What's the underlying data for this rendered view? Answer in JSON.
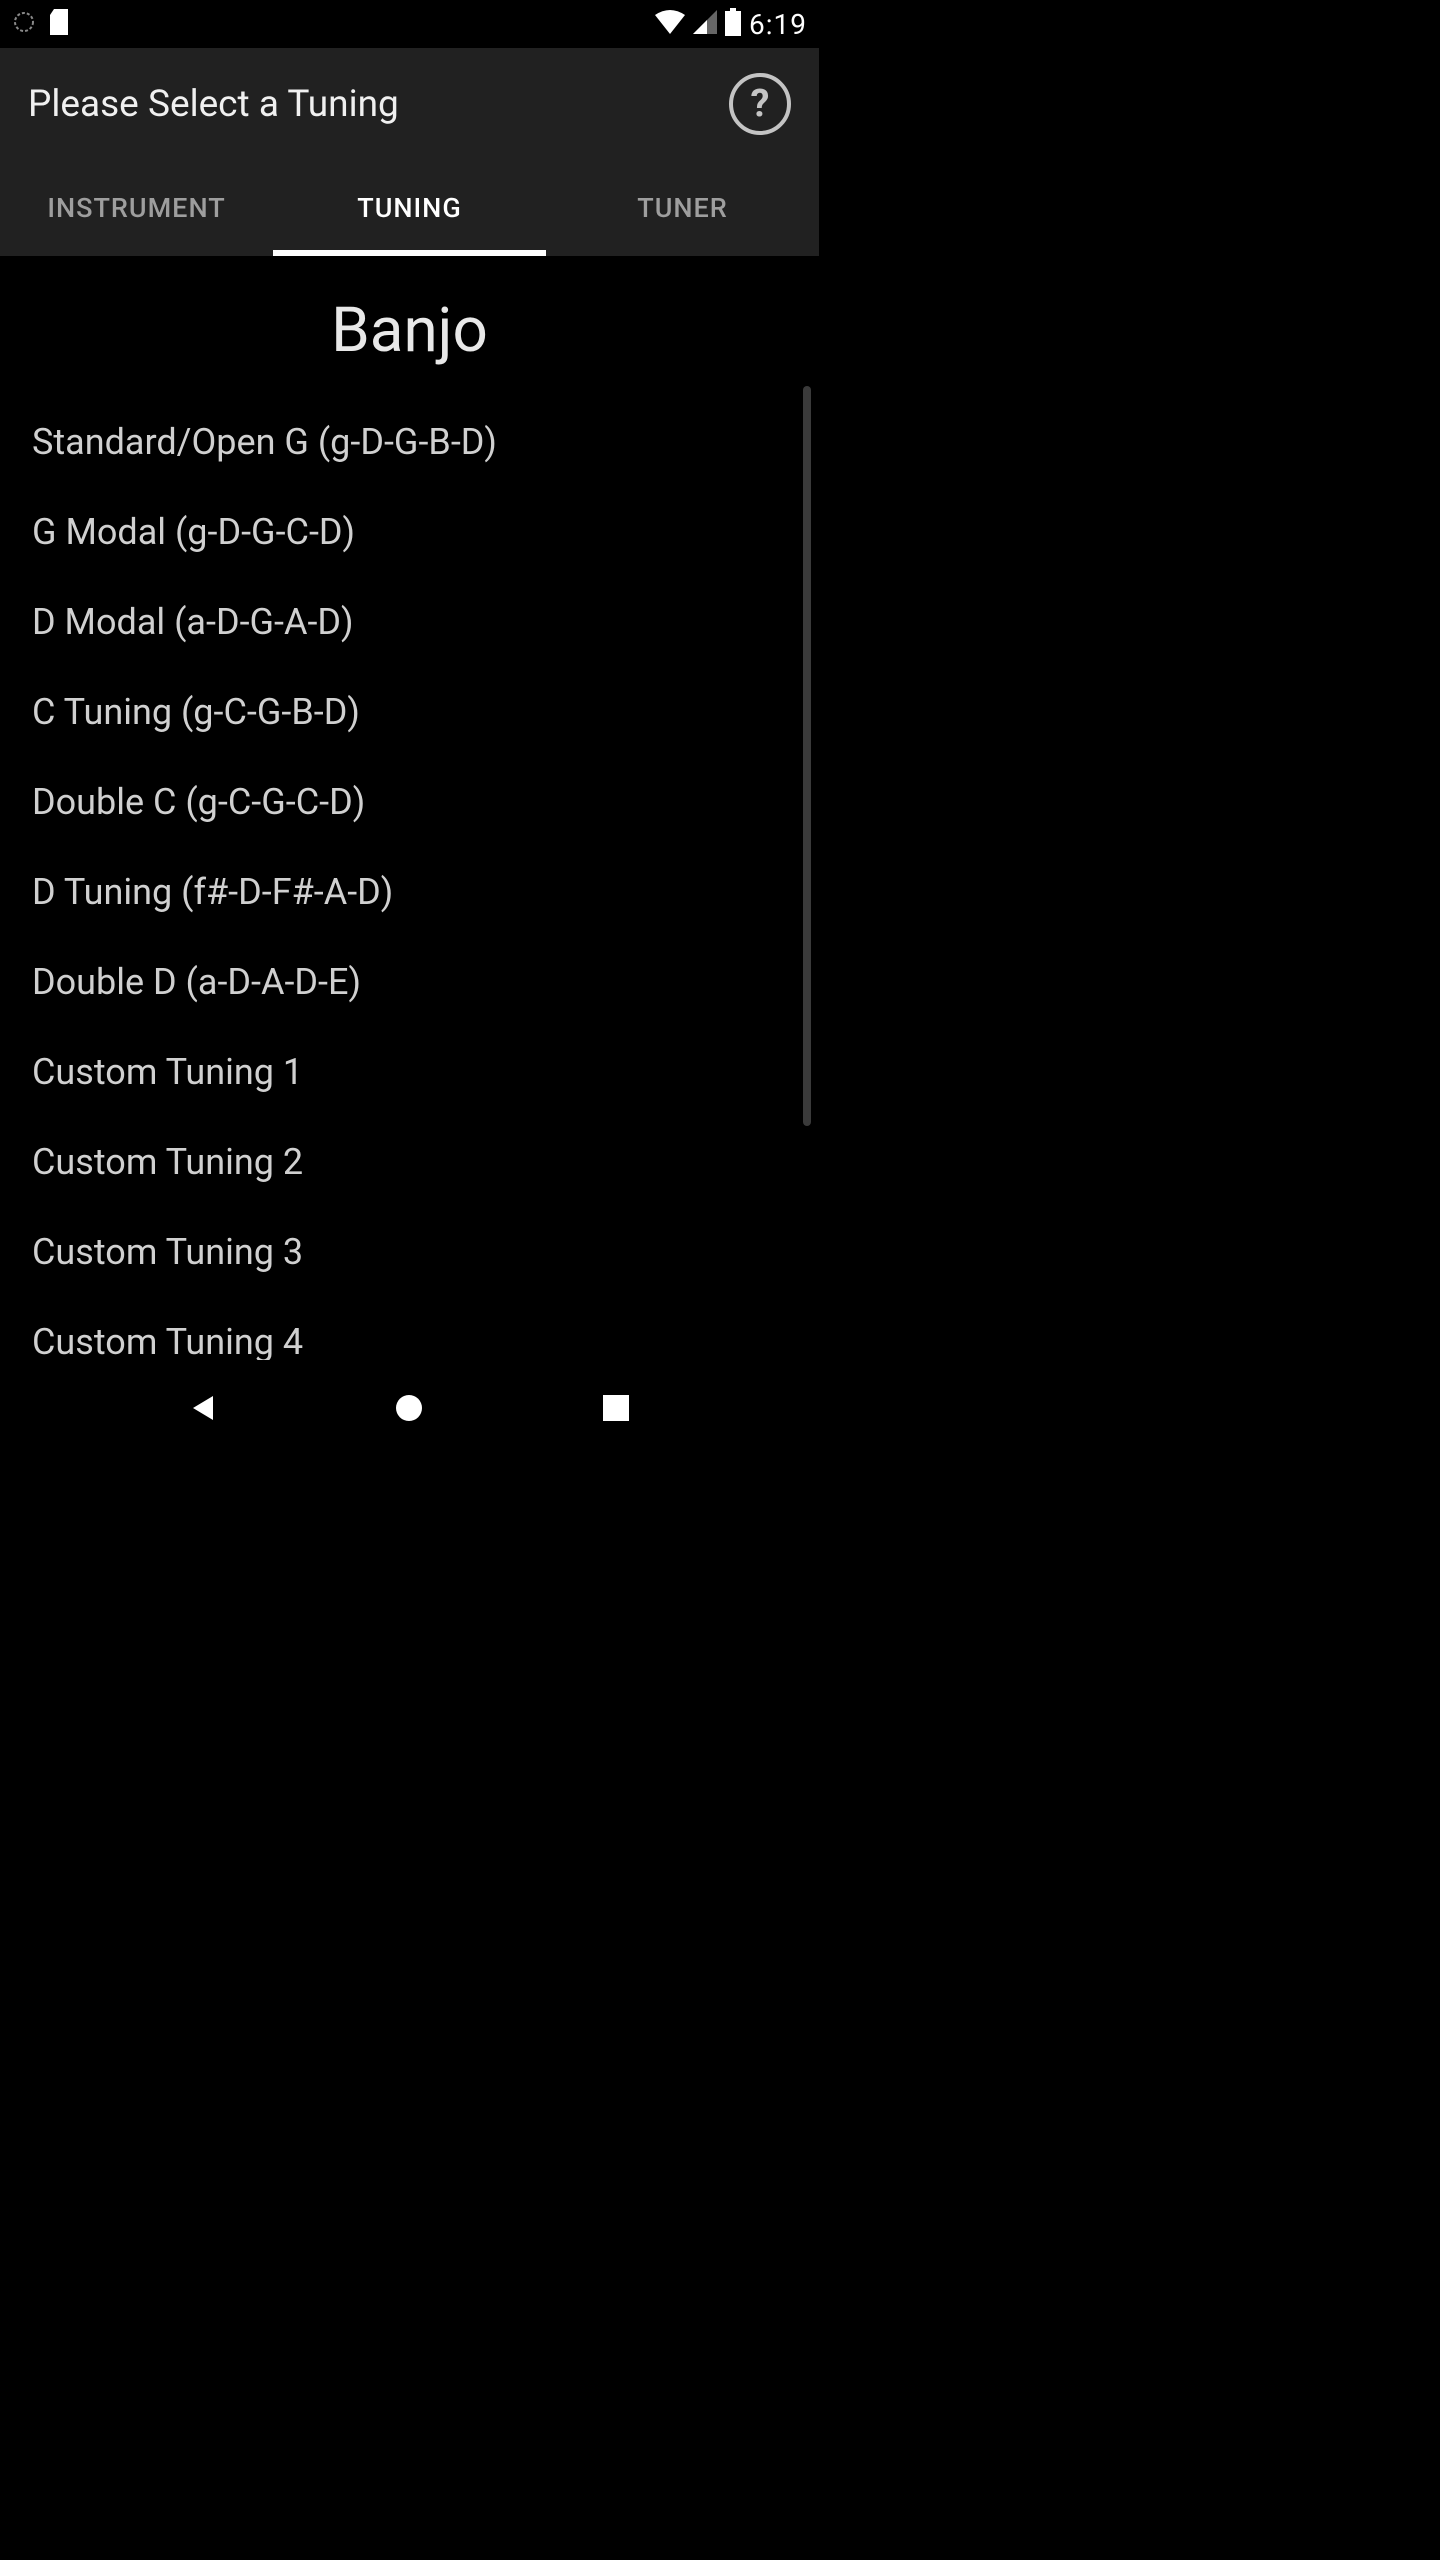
{
  "status": {
    "time": "6:19"
  },
  "toolbar": {
    "title": "Please Select a Tuning",
    "help_label": "?"
  },
  "tabs": {
    "items": [
      {
        "label": "INSTRUMENT",
        "active": false
      },
      {
        "label": "TUNING",
        "active": true
      },
      {
        "label": "TUNER",
        "active": false
      }
    ]
  },
  "content": {
    "instrument": "Banjo",
    "tunings": [
      {
        "label": "Standard/Open G (g-D-G-B-D)"
      },
      {
        "label": "G Modal (g-D-G-C-D)"
      },
      {
        "label": "D Modal (a-D-G-A-D)"
      },
      {
        "label": "C Tuning (g-C-G-B-D)"
      },
      {
        "label": "Double C (g-C-G-C-D)"
      },
      {
        "label": "D Tuning (f#-D-F#-A-D)"
      },
      {
        "label": "Double D (a-D-A-D-E)"
      },
      {
        "label": "Custom Tuning 1"
      },
      {
        "label": "Custom Tuning 2"
      },
      {
        "label": "Custom Tuning 3"
      },
      {
        "label": "Custom Tuning 4"
      }
    ]
  }
}
